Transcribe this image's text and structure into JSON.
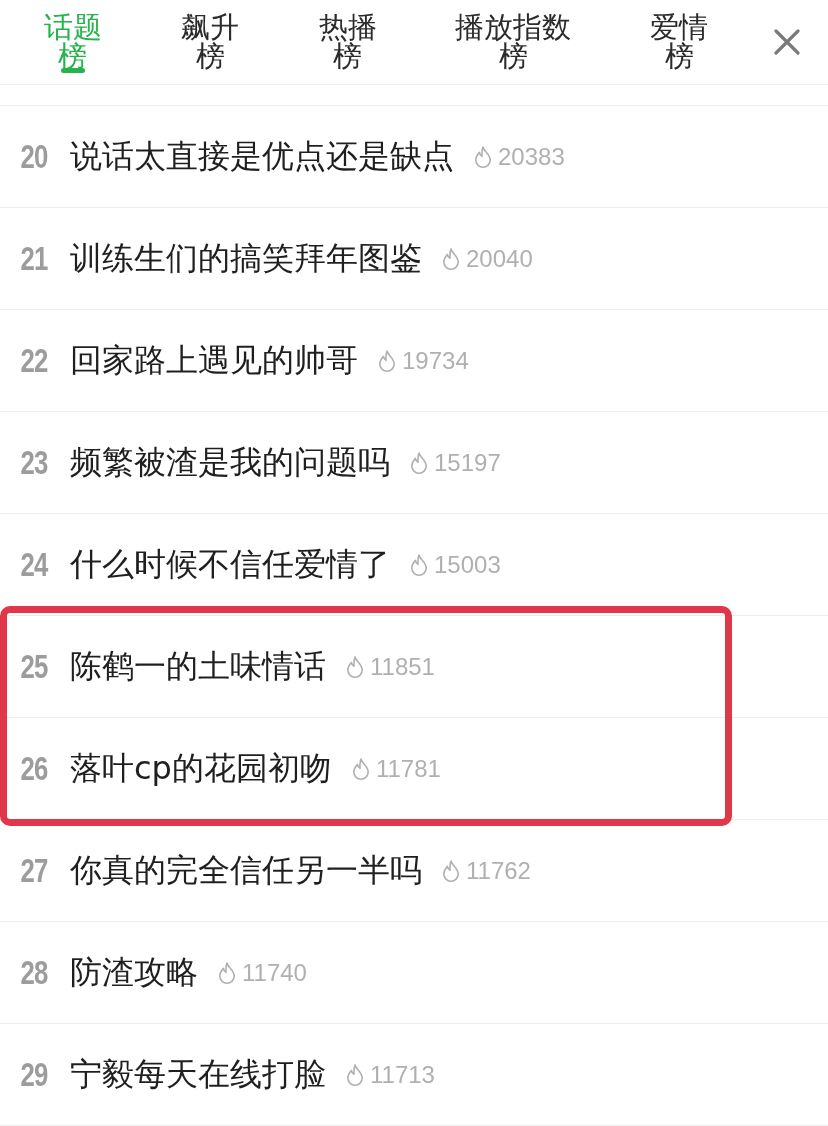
{
  "tabs": [
    {
      "label": "话题榜",
      "selected": true
    },
    {
      "label": "飙升榜",
      "selected": false
    },
    {
      "label": "热播榜",
      "selected": false
    },
    {
      "label": "播放指数榜",
      "selected": false
    },
    {
      "label": "爱情榜",
      "selected": false
    }
  ],
  "list": {
    "items": [
      {
        "rank": "20",
        "title": "说话太直接是优点还是缺点",
        "heat": "20383",
        "highlighted": false
      },
      {
        "rank": "21",
        "title": "训练生们的搞笑拜年图鉴",
        "heat": "20040",
        "highlighted": false
      },
      {
        "rank": "22",
        "title": "回家路上遇见的帅哥",
        "heat": "19734",
        "highlighted": false
      },
      {
        "rank": "23",
        "title": "频繁被渣是我的问题吗",
        "heat": "15197",
        "highlighted": false
      },
      {
        "rank": "24",
        "title": "什么时候不信任爱情了",
        "heat": "15003",
        "highlighted": false
      },
      {
        "rank": "25",
        "title": "陈鹤一的土味情话",
        "heat": "11851",
        "highlighted": true
      },
      {
        "rank": "26",
        "title": "落叶cp的花园初吻",
        "heat": "11781",
        "highlighted": true
      },
      {
        "rank": "27",
        "title": "你真的完全信任另一半吗",
        "heat": "11762",
        "highlighted": false
      },
      {
        "rank": "28",
        "title": "防渣攻略",
        "heat": "11740",
        "highlighted": false
      },
      {
        "rank": "29",
        "title": "宁毅每天在线打脸",
        "heat": "11713",
        "highlighted": false
      }
    ]
  }
}
